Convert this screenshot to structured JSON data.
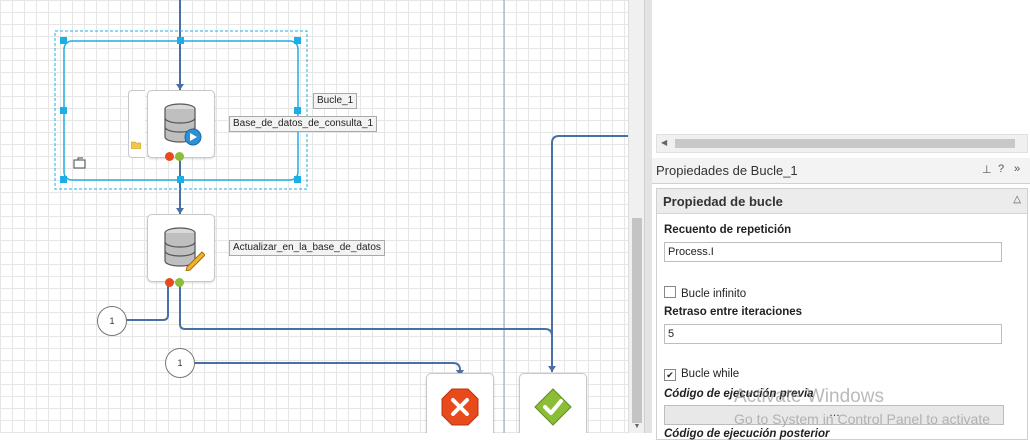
{
  "canvas": {
    "loop_container": {
      "label": "Bucle_1"
    },
    "nodes": [
      {
        "id": "query_db",
        "label": "Base_de_datos_de_consulta_1",
        "icon": "database-play-icon"
      },
      {
        "id": "update_db",
        "label": "Actualizar_en_la_base_de_datos",
        "icon": "database-edit-icon"
      },
      {
        "id": "end_error",
        "icon": "error-x-icon"
      },
      {
        "id": "end_success",
        "icon": "success-check-icon"
      }
    ],
    "circles": [
      {
        "label": "1"
      },
      {
        "label": "1"
      }
    ],
    "colors": {
      "selection": "#1eaee6",
      "connector": "#4a6fa5",
      "error": "#e84a1c",
      "success": "#8bbd36"
    }
  },
  "properties_panel": {
    "title": "Propiedades de Bucle_1",
    "header_icons": [
      "pin-icon",
      "help-icon",
      "expand-icon"
    ],
    "section": {
      "title": "Propiedad de bucle",
      "fields": [
        {
          "label": "Recuento de repetición",
          "value": "Process.I"
        },
        {
          "checkbox_label": "Bucle infinito",
          "checked": false
        },
        {
          "label": "Retraso entre iteraciones",
          "value": "5"
        },
        {
          "checkbox_label": "Bucle while",
          "checked": true
        },
        {
          "label": "Código de ejecución previa",
          "value": ""
        },
        {
          "label": "Código de ejecución posterior"
        }
      ]
    }
  },
  "watermark": {
    "line1": "Activate Windows",
    "line2": "Go to System in Control Panel to activate"
  }
}
